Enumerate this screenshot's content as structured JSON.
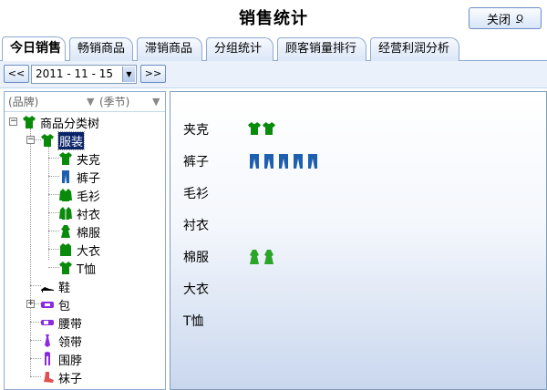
{
  "window": {
    "title": "销售统计",
    "close_label": "关闭",
    "close_key": "Q"
  },
  "tabs": [
    "今日销售",
    "畅销商品",
    "滞销商品",
    "分组统计",
    "顾客销量排行",
    "经营利润分析"
  ],
  "date_bar": {
    "prev_label": "<<",
    "next_label": ">>",
    "date_value": "2011 - 11 - 15"
  },
  "filters": {
    "brand": "(品牌)",
    "season": "(季节)"
  },
  "tree": {
    "root": "商品分类树",
    "clothing": "服装",
    "clothing_children": [
      "夹克",
      "裤子",
      "毛衫",
      "衬衣",
      "棉服",
      "大衣",
      "T恤"
    ],
    "others": [
      "鞋",
      "包",
      "腰带",
      "领带",
      "围脖",
      "袜子"
    ]
  },
  "sales": [
    {
      "label": "夹克",
      "icon": "green-tshirt-icon",
      "count": 2
    },
    {
      "label": "裤子",
      "icon": "blue-pants-icon",
      "count": 5
    },
    {
      "label": "毛衫",
      "icon": "",
      "count": 0
    },
    {
      "label": "衬衣",
      "icon": "",
      "count": 0
    },
    {
      "label": "棉服",
      "icon": "green-coat-icon",
      "count": 2
    },
    {
      "label": "大衣",
      "icon": "",
      "count": 0
    },
    {
      "label": "T恤",
      "icon": "",
      "count": 0
    }
  ],
  "colors": {
    "accent": "#0a246a",
    "tab_border": "#8fa9d2",
    "green": "#0a8a0a",
    "blue": "#1f5fb0",
    "purple": "#8a2be2"
  }
}
